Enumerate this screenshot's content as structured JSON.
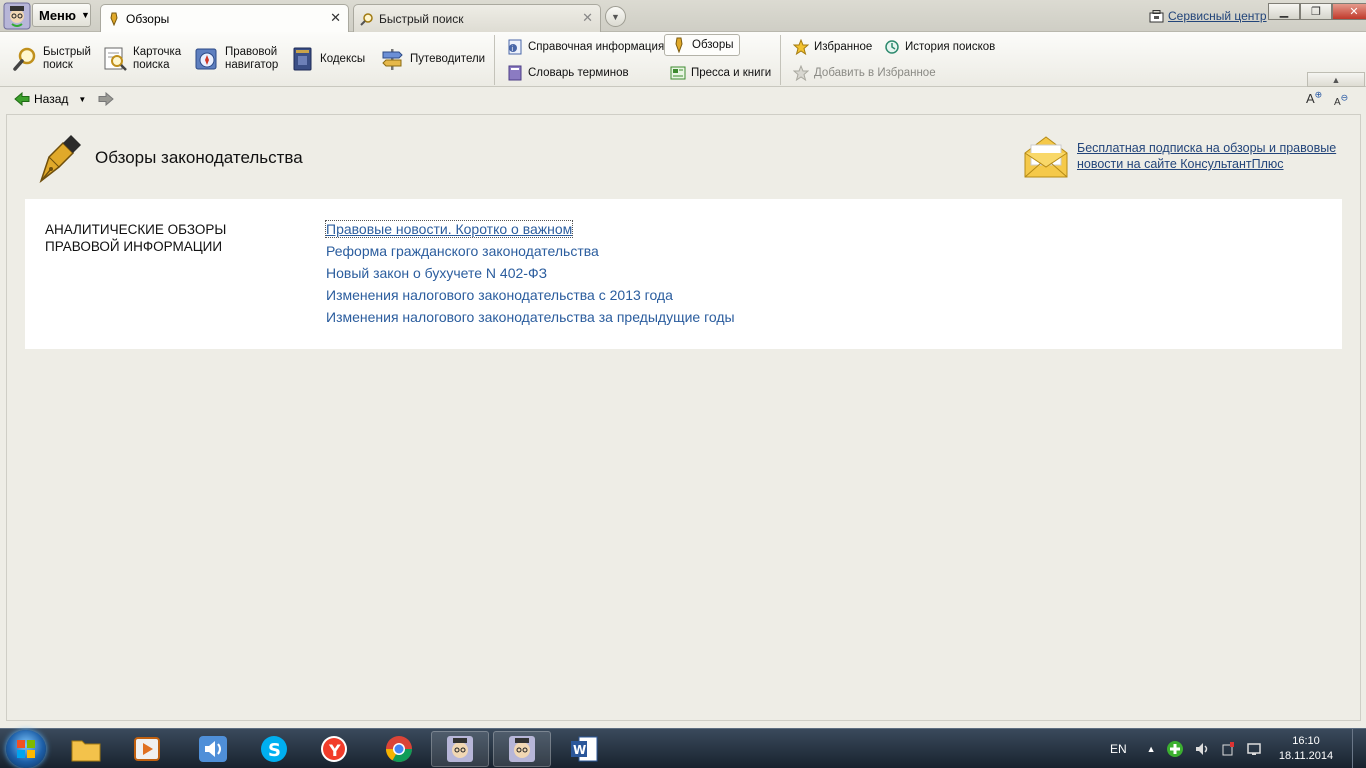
{
  "titlebar": {
    "menu_label": "Меню",
    "tabs": [
      {
        "label": "Обзоры",
        "active": true
      },
      {
        "label": "Быстрый поиск",
        "active": false
      }
    ],
    "service_center": "Сервисный центр"
  },
  "toolbar": {
    "quick_search": "Быстрый поиск",
    "card_search": "Карточка поиска",
    "legal_navigator": "Правовой навигатор",
    "codes": "Кодексы",
    "guides": "Путеводители",
    "reference_info": "Справочная информация",
    "reviews": "Обзоры",
    "glossary": "Словарь терминов",
    "press_books": "Пресса и книги",
    "favorites": "Избранное",
    "search_history": "История поисков",
    "add_favorites": "Добавить в Избранное"
  },
  "nav": {
    "back_label": "Назад"
  },
  "page": {
    "title": "Обзоры законодательства",
    "promo_link": "Бесплатная подписка на обзоры и правовые новости на сайте КонсультантПлюс",
    "section_label": "АНАЛИТИЧЕСКИЕ ОБЗОРЫ ПРАВОВОЙ ИНФОРМАЦИИ",
    "links": [
      "Правовые новости. Коротко о важном",
      "Реформа гражданского законодательства",
      "Новый закон о бухучете N 402-ФЗ",
      "Изменения налогового законодательства с 2013 года",
      "Изменения налогового законодательства за предыдущие годы"
    ]
  },
  "taskbar": {
    "language": "EN",
    "time": "16:10",
    "date": "18.11.2014"
  },
  "colors": {
    "link": "#2b5d9e",
    "background": "#eeede6",
    "content_bg": "#ffffff"
  }
}
